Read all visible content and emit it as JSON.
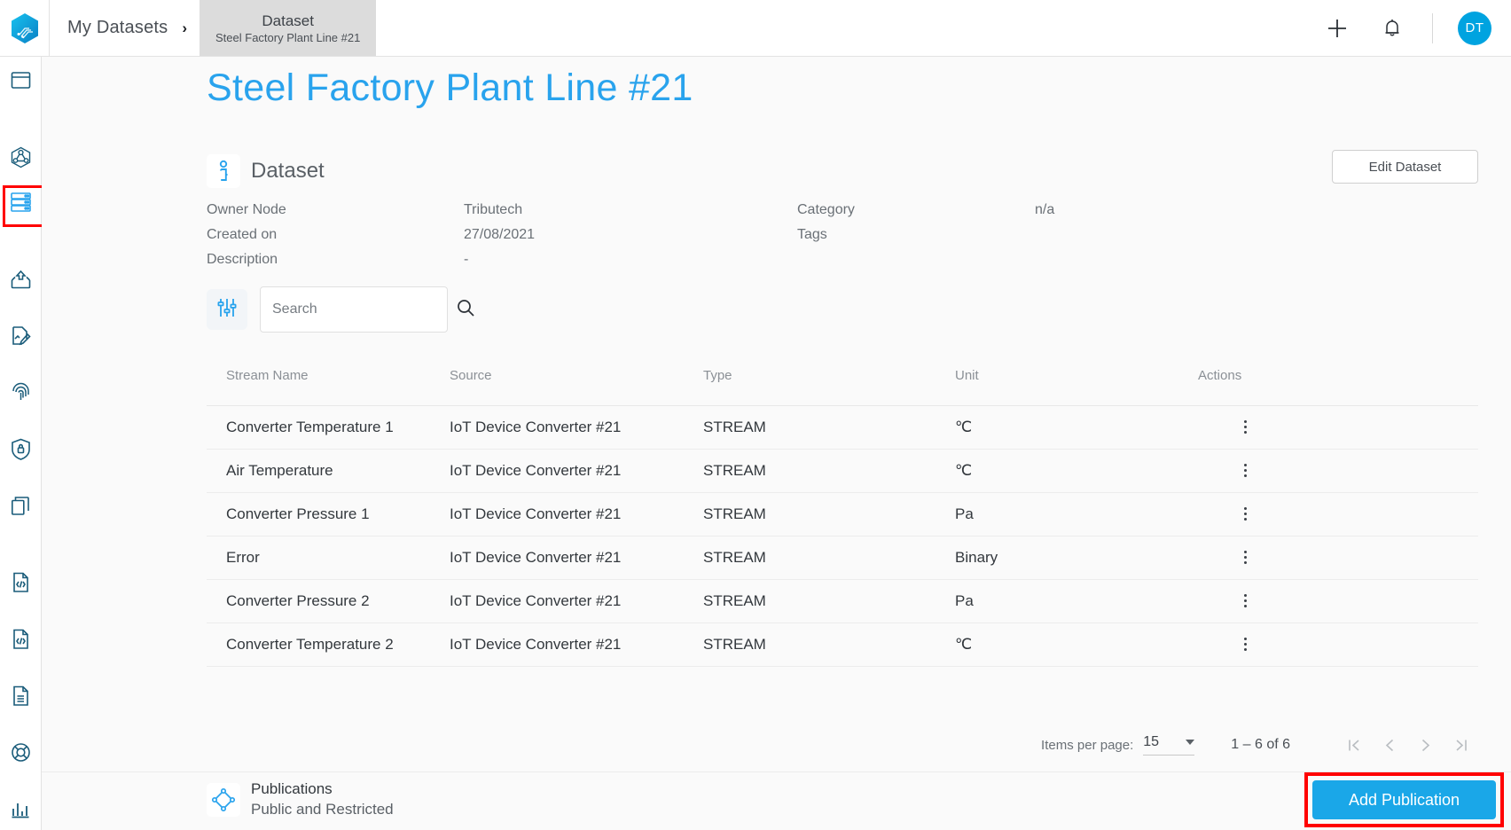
{
  "topbar": {
    "logo_icon": "hexagon-logo-icon",
    "breadcrumb_root": "My Datasets",
    "breadcrumb_separator": "›",
    "breadcrumb_active_type": "Dataset",
    "breadcrumb_active_name": "Steel Factory Plant Line #21",
    "add_icon": "plus-icon",
    "notifications_icon": "bell-icon",
    "avatar_initials": "DT",
    "avatar_color": "#00a3e0"
  },
  "sidebar": {
    "items": [
      {
        "icon": "browser-window-icon",
        "name": "sidebar-item-dashboard",
        "highlighted": false
      },
      {
        "icon": "network-nodes-icon",
        "name": "sidebar-item-network",
        "highlighted": false
      },
      {
        "icon": "database-server-icon",
        "name": "sidebar-item-datasets",
        "highlighted": true
      },
      {
        "icon": "upload-inbox-icon",
        "name": "sidebar-item-upload",
        "highlighted": false
      },
      {
        "icon": "document-edit-icon",
        "name": "sidebar-item-contracts",
        "highlighted": false
      },
      {
        "icon": "fingerprint-icon",
        "name": "sidebar-item-identity",
        "highlighted": false
      },
      {
        "icon": "shield-lock-icon",
        "name": "sidebar-item-security",
        "highlighted": false
      },
      {
        "icon": "copy-layers-icon",
        "name": "sidebar-item-copies",
        "highlighted": false
      },
      {
        "icon": "code-file-icon",
        "name": "sidebar-item-code-1",
        "highlighted": false
      },
      {
        "icon": "code-file-icon",
        "name": "sidebar-item-code-2",
        "highlighted": false
      },
      {
        "icon": "text-file-icon",
        "name": "sidebar-item-logs",
        "highlighted": false
      },
      {
        "icon": "lifebuoy-icon",
        "name": "sidebar-item-support",
        "highlighted": false
      },
      {
        "icon": "bar-chart-icon",
        "name": "sidebar-item-analytics",
        "highlighted": false
      }
    ]
  },
  "page": {
    "title": "Steel Factory Plant Line #21",
    "title_color": "#29a3ed"
  },
  "dataset_section": {
    "icon": "dataset-info-icon",
    "title": "Dataset",
    "edit_button": "Edit Dataset",
    "fields": {
      "owner_node_label": "Owner Node",
      "owner_node_value": "Tributech",
      "created_on_label": "Created on",
      "created_on_value": "27/08/2021",
      "description_label": "Description",
      "description_value": "-",
      "category_label": "Category",
      "category_value": "n/a",
      "tags_label": "Tags",
      "tags_value": ""
    }
  },
  "toolbar": {
    "filter_icon": "filter-sliders-icon",
    "search_placeholder": "Search",
    "search_value": "",
    "search_icon": "magnifier-icon"
  },
  "table": {
    "columns": [
      "Stream Name",
      "Source",
      "Type",
      "Unit",
      "Actions"
    ],
    "rows": [
      {
        "stream_name": "Converter Temperature 1",
        "source": "IoT Device Converter #21",
        "type": "STREAM",
        "unit": "℃"
      },
      {
        "stream_name": "Air Temperature",
        "source": "IoT Device Converter #21",
        "type": "STREAM",
        "unit": "℃"
      },
      {
        "stream_name": "Converter Pressure 1",
        "source": "IoT Device Converter #21",
        "type": "STREAM",
        "unit": "Pa"
      },
      {
        "stream_name": "Error",
        "source": "IoT Device Converter #21",
        "type": "STREAM",
        "unit": "Binary"
      },
      {
        "stream_name": "Converter Pressure 2",
        "source": "IoT Device Converter #21",
        "type": "STREAM",
        "unit": "Pa"
      },
      {
        "stream_name": "Converter Temperature 2",
        "source": "IoT Device Converter #21",
        "type": "STREAM",
        "unit": "℃"
      }
    ],
    "row_action_icon": "kebab-menu-icon"
  },
  "paginator": {
    "items_per_page_label": "Items per page:",
    "items_per_page_value": "15",
    "range_label": "1 – 6 of 6",
    "first_icon": "first-page-icon",
    "prev_icon": "previous-page-icon",
    "next_icon": "next-page-icon",
    "last_icon": "last-page-icon"
  },
  "publications": {
    "icon": "publication-diamond-icon",
    "title": "Publications",
    "subtitle": "Public and Restricted",
    "add_button": "Add Publication",
    "add_button_color": "#1aa7e8",
    "highlight_color": "#ff0000"
  }
}
